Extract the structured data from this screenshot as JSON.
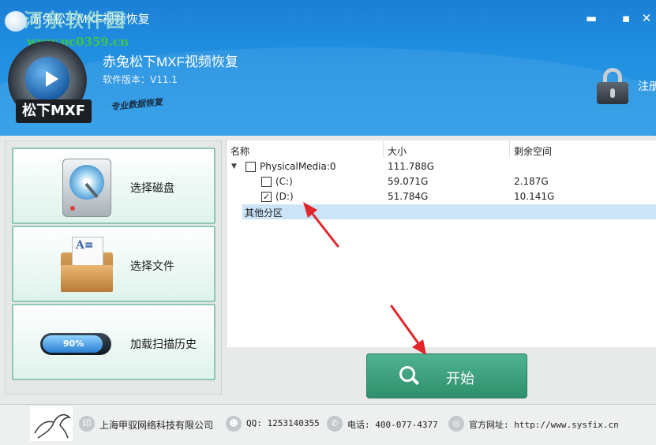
{
  "window": {
    "title": "赤兔松下MXF视频恢复",
    "minimize_glyph": "▬",
    "maximize_glyph": "▪",
    "close_glyph": "✕"
  },
  "watermark": {
    "site_name": "河东软件园",
    "url": "www.pc0359.cn"
  },
  "header": {
    "logo_label": "松下MXF",
    "app_name": "赤兔松下MXF视频恢复",
    "version": "软件版本：V11.1",
    "slogan": "专业数据恢复",
    "register_label": "注册"
  },
  "sidebar": {
    "items": [
      {
        "label": "选择磁盘",
        "icon": "hard-disk-icon"
      },
      {
        "label": "选择文件",
        "icon": "folder-icon"
      },
      {
        "label": "加载扫描历史",
        "icon": "progress-icon",
        "progress_text": "90%",
        "progress_value": 0.9
      }
    ]
  },
  "table": {
    "columns": [
      "名称",
      "大小",
      "剩余空间"
    ],
    "rows": [
      {
        "name": "PhysicalMedia:0",
        "size": "111.788G",
        "free": "",
        "checked": false,
        "expanded": true,
        "level": 0
      },
      {
        "name": "(C:)",
        "size": "59.071G",
        "free": "2.187G",
        "checked": false,
        "level": 1
      },
      {
        "name": "(D:)",
        "size": "51.784G",
        "free": "10.141G",
        "checked": true,
        "level": 1
      },
      {
        "name": "其他分区",
        "size": "",
        "free": "",
        "selected": true,
        "level": 1
      }
    ],
    "check_glyph": "✓",
    "expand_glyph": "▼"
  },
  "start_button": {
    "label": "开始"
  },
  "footer": {
    "company": "上海甲驭网络科技有限公司",
    "qq": "QQ: 1253140355",
    "phone": "电话: 400-077-4377",
    "website": "官方网址: http://www.sysfix.cn"
  },
  "colors": {
    "header_blue": "#1f8ee0",
    "start_green": "#3fa37f",
    "sidebar_border": "#8fc7b2",
    "selection": "#cce4f7",
    "annotation_red": "#e0262a"
  }
}
